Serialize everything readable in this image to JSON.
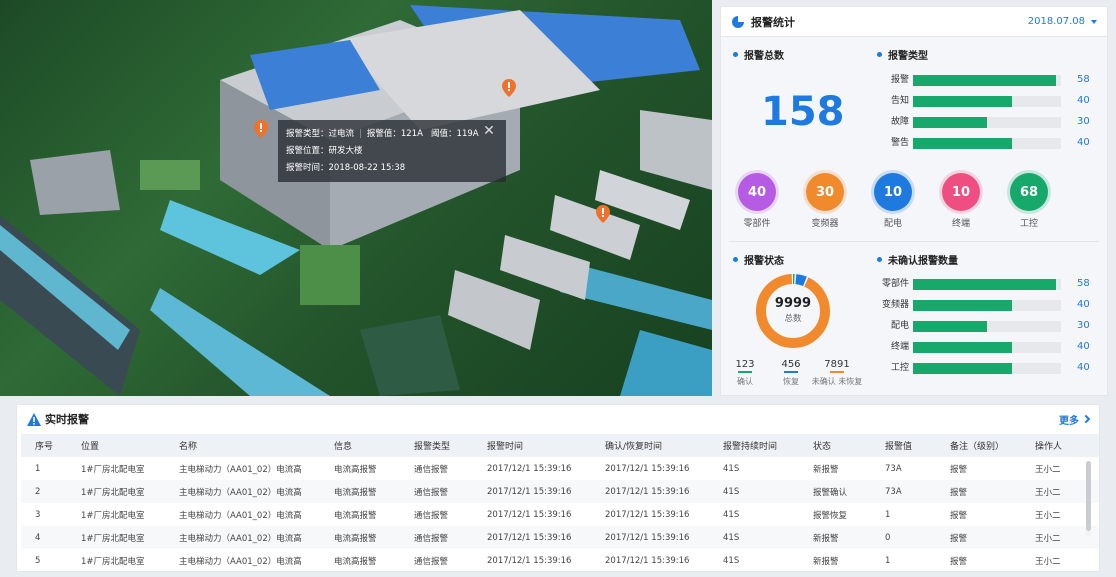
{
  "map": {
    "popup": {
      "type_label": "报警类型：过电流",
      "value_label": "报警值：121A",
      "threshold_label": "阈值：119A",
      "location_label": "报警位置：研发大楼",
      "time_label": "报警时间：2018-08-22 15:38"
    }
  },
  "stats": {
    "title": "报警统计",
    "date": "2018.07.08",
    "total_title": "报警总数",
    "total": "158",
    "type_title": "报警类型",
    "types": [
      {
        "label": "报警",
        "value": 58
      },
      {
        "label": "告知",
        "value": 40
      },
      {
        "label": "故障",
        "value": 30
      },
      {
        "label": "警告",
        "value": 40
      }
    ],
    "categories": [
      {
        "label": "零部件",
        "value": "40",
        "color": "#b65be3"
      },
      {
        "label": "变频器",
        "value": "30",
        "color": "#f08a2c"
      },
      {
        "label": "配电",
        "value": "10",
        "color": "#1f7ae0"
      },
      {
        "label": "终端",
        "value": "10",
        "color": "#ef4f80"
      },
      {
        "label": "工控",
        "value": "68",
        "color": "#17a86b"
      }
    ],
    "status_title": "报警状态",
    "status_total": "9999",
    "status_total_label": "总数",
    "status_items": [
      {
        "value": "123",
        "label": "确认",
        "color": "#17a86b"
      },
      {
        "value": "456",
        "label": "恢复",
        "color": "#1f7ae0"
      },
      {
        "value": "7891",
        "label": "未确认 未恢复",
        "color": "#f08a2c"
      }
    ],
    "unconfirmed_title": "未确认报警数量",
    "unconfirmed": [
      {
        "label": "零部件",
        "value": 58
      },
      {
        "label": "变频器",
        "value": 40
      },
      {
        "label": "配电",
        "value": 30
      },
      {
        "label": "终端",
        "value": 40
      },
      {
        "label": "工控",
        "value": 40
      }
    ],
    "bar_max": 60
  },
  "alarm": {
    "title": "实时报警",
    "more": "更多",
    "columns": [
      "序号",
      "位置",
      "名称",
      "信息",
      "报警类型",
      "报警时间",
      "确认/恢复时间",
      "报警持续时间",
      "状态",
      "报警值",
      "备注（级别）",
      "操作人"
    ],
    "rows": [
      [
        "1",
        "1#厂房北配电室",
        "主电梯动力（AA01_02）电流高",
        "电流高报警",
        "通信报警",
        "2017/12/1 15:39:16",
        "2017/12/1 15:39:16",
        "41S",
        "新报警",
        "73A",
        "报警",
        "王小二"
      ],
      [
        "2",
        "1#厂房北配电室",
        "主电梯动力（AA01_02）电流高",
        "电流高报警",
        "通信报警",
        "2017/12/1 15:39:16",
        "2017/12/1 15:39:16",
        "41S",
        "报警确认",
        "73A",
        "报警",
        "王小二"
      ],
      [
        "3",
        "1#厂房北配电室",
        "主电梯动力（AA01_02）电流高",
        "电流高报警",
        "通信报警",
        "2017/12/1 15:39:16",
        "2017/12/1 15:39:16",
        "41S",
        "报警恢复",
        "1",
        "报警",
        "王小二"
      ],
      [
        "4",
        "1#厂房北配电室",
        "主电梯动力（AA01_02）电流高",
        "电流高报警",
        "通信报警",
        "2017/12/1 15:39:16",
        "2017/12/1 15:39:16",
        "41S",
        "新报警",
        "0",
        "报警",
        "王小二"
      ],
      [
        "5",
        "1#厂房北配电室",
        "主电梯动力（AA01_02）电流高",
        "电流高报警",
        "通信报警",
        "2017/12/1 15:39:16",
        "2017/12/1 15:39:16",
        "41S",
        "新报警",
        "1",
        "报警",
        "王小二"
      ]
    ]
  }
}
